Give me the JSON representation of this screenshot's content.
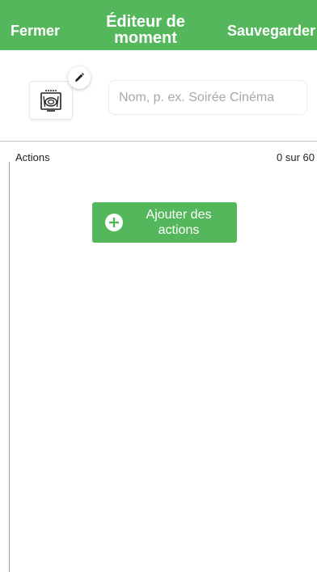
{
  "header": {
    "close_label": "Fermer",
    "title": "Éditeur de moment",
    "save_label": "Sauvegarder",
    "background_color": "#55b75b"
  },
  "editor": {
    "moment_icon": "tv-dinner-icon",
    "edit_icon": "pencil-icon",
    "name_input": {
      "value": "",
      "placeholder": "Nom, p. ex. Soirée Cinéma"
    }
  },
  "actions": {
    "label": "Actions",
    "count": "0 sur 60",
    "add_button_label": "Ajouter des actions",
    "add_icon": "plus-circle-icon"
  }
}
